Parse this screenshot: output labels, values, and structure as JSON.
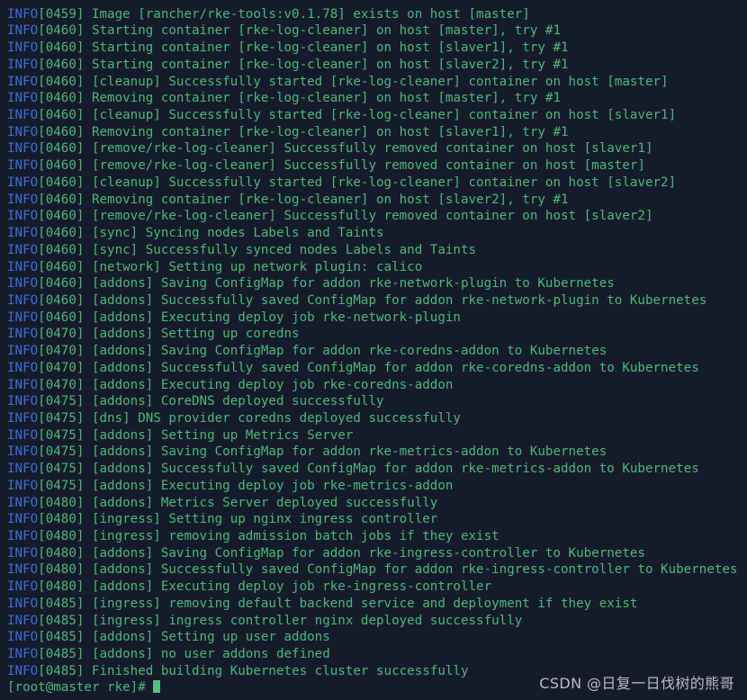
{
  "terminal": {
    "background_color": "#161b2c",
    "level_color": "#3b6fd4",
    "message_color": "#4cb977",
    "cursor_color": "#56c07f",
    "watermark_color": "#c6cad6",
    "level_label": "INFO",
    "lines": [
      {
        "level": "INFO",
        "time": "[0459]",
        "message": "Image [rancher/rke-tools:v0.1.78] exists on host [master]"
      },
      {
        "level": "INFO",
        "time": "[0460]",
        "message": "Starting container [rke-log-cleaner] on host [master], try #1"
      },
      {
        "level": "INFO",
        "time": "[0460]",
        "message": "Starting container [rke-log-cleaner] on host [slaver1], try #1"
      },
      {
        "level": "INFO",
        "time": "[0460]",
        "message": "Starting container [rke-log-cleaner] on host [slaver2], try #1"
      },
      {
        "level": "INFO",
        "time": "[0460]",
        "message": "[cleanup] Successfully started [rke-log-cleaner] container on host [master]"
      },
      {
        "level": "INFO",
        "time": "[0460]",
        "message": "Removing container [rke-log-cleaner] on host [master], try #1"
      },
      {
        "level": "INFO",
        "time": "[0460]",
        "message": "[cleanup] Successfully started [rke-log-cleaner] container on host [slaver1]"
      },
      {
        "level": "INFO",
        "time": "[0460]",
        "message": "Removing container [rke-log-cleaner] on host [slaver1], try #1"
      },
      {
        "level": "INFO",
        "time": "[0460]",
        "message": "[remove/rke-log-cleaner] Successfully removed container on host [slaver1]"
      },
      {
        "level": "INFO",
        "time": "[0460]",
        "message": "[remove/rke-log-cleaner] Successfully removed container on host [master]"
      },
      {
        "level": "INFO",
        "time": "[0460]",
        "message": "[cleanup] Successfully started [rke-log-cleaner] container on host [slaver2]"
      },
      {
        "level": "INFO",
        "time": "[0460]",
        "message": "Removing container [rke-log-cleaner] on host [slaver2], try #1"
      },
      {
        "level": "INFO",
        "time": "[0460]",
        "message": "[remove/rke-log-cleaner] Successfully removed container on host [slaver2]"
      },
      {
        "level": "INFO",
        "time": "[0460]",
        "message": "[sync] Syncing nodes Labels and Taints"
      },
      {
        "level": "INFO",
        "time": "[0460]",
        "message": "[sync] Successfully synced nodes Labels and Taints"
      },
      {
        "level": "INFO",
        "time": "[0460]",
        "message": "[network] Setting up network plugin: calico"
      },
      {
        "level": "INFO",
        "time": "[0460]",
        "message": "[addons] Saving ConfigMap for addon rke-network-plugin to Kubernetes"
      },
      {
        "level": "INFO",
        "time": "[0460]",
        "message": "[addons] Successfully saved ConfigMap for addon rke-network-plugin to Kubernetes"
      },
      {
        "level": "INFO",
        "time": "[0460]",
        "message": "[addons] Executing deploy job rke-network-plugin"
      },
      {
        "level": "INFO",
        "time": "[0470]",
        "message": "[addons] Setting up coredns"
      },
      {
        "level": "INFO",
        "time": "[0470]",
        "message": "[addons] Saving ConfigMap for addon rke-coredns-addon to Kubernetes"
      },
      {
        "level": "INFO",
        "time": "[0470]",
        "message": "[addons] Successfully saved ConfigMap for addon rke-coredns-addon to Kubernetes"
      },
      {
        "level": "INFO",
        "time": "[0470]",
        "message": "[addons] Executing deploy job rke-coredns-addon"
      },
      {
        "level": "INFO",
        "time": "[0475]",
        "message": "[addons] CoreDNS deployed successfully"
      },
      {
        "level": "INFO",
        "time": "[0475]",
        "message": "[dns] DNS provider coredns deployed successfully"
      },
      {
        "level": "INFO",
        "time": "[0475]",
        "message": "[addons] Setting up Metrics Server"
      },
      {
        "level": "INFO",
        "time": "[0475]",
        "message": "[addons] Saving ConfigMap for addon rke-metrics-addon to Kubernetes"
      },
      {
        "level": "INFO",
        "time": "[0475]",
        "message": "[addons] Successfully saved ConfigMap for addon rke-metrics-addon to Kubernetes"
      },
      {
        "level": "INFO",
        "time": "[0475]",
        "message": "[addons] Executing deploy job rke-metrics-addon"
      },
      {
        "level": "INFO",
        "time": "[0480]",
        "message": "[addons] Metrics Server deployed successfully"
      },
      {
        "level": "INFO",
        "time": "[0480]",
        "message": "[ingress] Setting up nginx ingress controller"
      },
      {
        "level": "INFO",
        "time": "[0480]",
        "message": "[ingress] removing admission batch jobs if they exist"
      },
      {
        "level": "INFO",
        "time": "[0480]",
        "message": "[addons] Saving ConfigMap for addon rke-ingress-controller to Kubernetes"
      },
      {
        "level": "INFO",
        "time": "[0480]",
        "message": "[addons] Successfully saved ConfigMap for addon rke-ingress-controller to Kubernetes"
      },
      {
        "level": "INFO",
        "time": "[0480]",
        "message": "[addons] Executing deploy job rke-ingress-controller"
      },
      {
        "level": "INFO",
        "time": "[0485]",
        "message": "[ingress] removing default backend service and deployment if they exist"
      },
      {
        "level": "INFO",
        "time": "[0485]",
        "message": "[ingress] ingress controller nginx deployed successfully"
      },
      {
        "level": "INFO",
        "time": "[0485]",
        "message": "[addons] Setting up user addons"
      },
      {
        "level": "INFO",
        "time": "[0485]",
        "message": "[addons] no user addons defined"
      },
      {
        "level": "INFO",
        "time": "[0485]",
        "message": "Finished building Kubernetes cluster successfully"
      }
    ],
    "prompt": "[root@master rke]# ",
    "command_input": ""
  },
  "watermark": {
    "text": "CSDN @日复一日伐树的熊哥"
  }
}
